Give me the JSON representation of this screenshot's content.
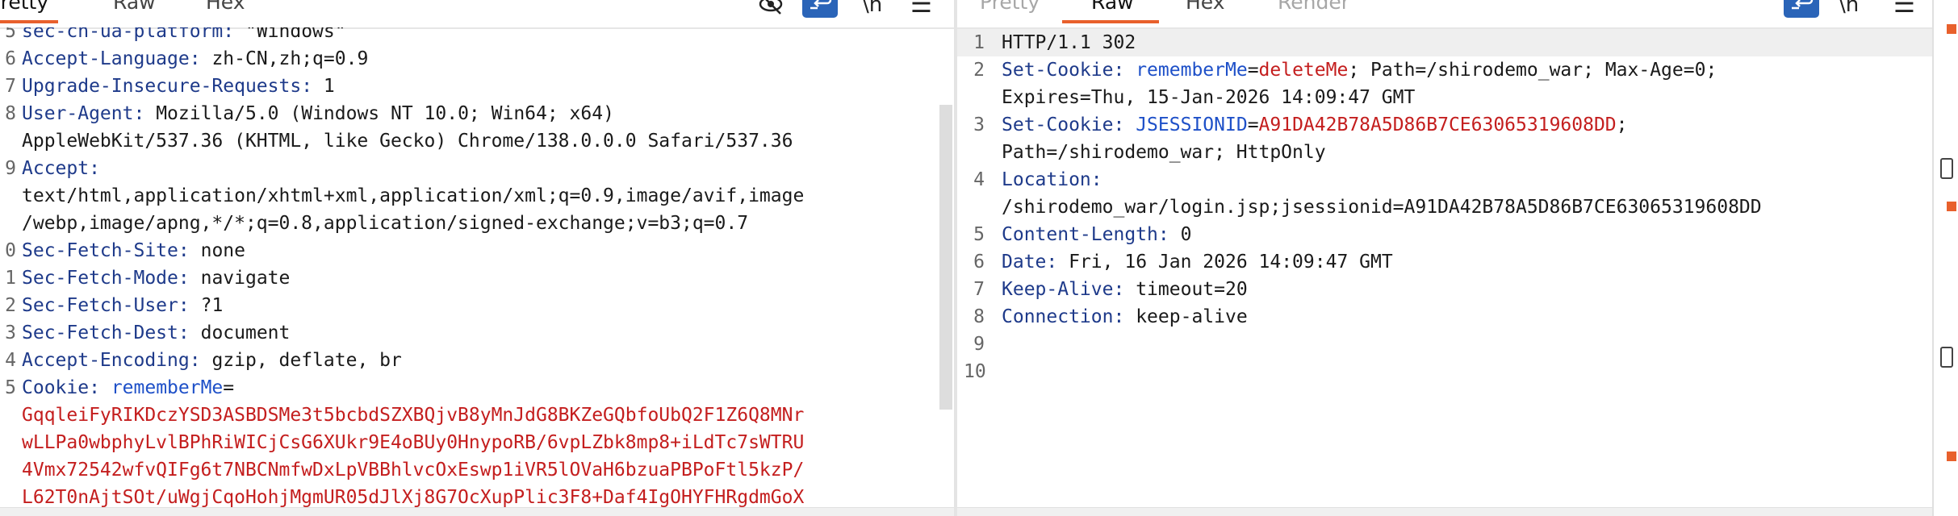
{
  "request": {
    "tabs": [
      "Pretty",
      "Raw",
      "Hex"
    ],
    "active_tab": "Pretty",
    "line_numbers": [
      "5",
      "6",
      "7",
      "8",
      "",
      "9",
      "",
      "",
      "0",
      "1",
      "2",
      "3",
      "4",
      "5",
      "",
      "",
      "",
      ""
    ],
    "lines": [
      {
        "k": "sec-ch-ua-platform",
        "v": "\"Windows\""
      },
      {
        "k": "Accept-Language",
        "v": "zh-CN,zh;q=0.9"
      },
      {
        "k": "Upgrade-Insecure-Requests",
        "v": "1"
      },
      {
        "k": "User-Agent",
        "v": "Mozilla/5.0 (Windows NT 10.0; Win64; x64)"
      },
      {
        "v": "AppleWebKit/537.36 (KHTML, like Gecko) Chrome/138.0.0.0 Safari/537.36"
      },
      {
        "k": "Accept"
      },
      {
        "v": "text/html,application/xhtml+xml,application/xml;q=0.9,image/avif,image"
      },
      {
        "v": "/webp,image/apng,*/*;q=0.8,application/signed-exchange;v=b3;q=0.7"
      },
      {
        "k": "Sec-Fetch-Site",
        "v": "none"
      },
      {
        "k": "Sec-Fetch-Mode",
        "v": "navigate"
      },
      {
        "k": "Sec-Fetch-User",
        "v": "?1"
      },
      {
        "k": "Sec-Fetch-Dest",
        "v": "document"
      },
      {
        "k": "Accept-Encoding",
        "v": "gzip, deflate, br"
      },
      {
        "k": "Cookie",
        "n": "rememberMe",
        "eq": "="
      },
      {
        "r": "GqqleiFyRIKDczYSD3ASBDSMe3t5bcbdSZXBQjvB8yMnJdG8BKZeGQbfoUbQ2F1Z6Q8MNr"
      },
      {
        "r": "wLLPa0wbphyLvlBPhRiWICjCsG6XUkr9E4oBUy0HnypoRB/6vpLZbk8mp8+iLdTc7sWTRU"
      },
      {
        "r": "4Vmx72542wfvQIFg6t7NBCNmfwDxLpVBBhlvcOxEswp1iVR5lOVaH6bzuaPBPoFtl5kzP/"
      },
      {
        "r": "L62T0nAjtSOt/uWgjCqoHohjMgmUR05dJlXj8G7OcXupPlic3F8+Daf4IgOHYFHRgdmGoX"
      }
    ]
  },
  "response": {
    "tabs": [
      "Pretty",
      "Raw",
      "Hex",
      "Render"
    ],
    "active_tab": "Raw",
    "line_numbers": [
      "1",
      "2",
      "",
      "3",
      "",
      "4",
      "",
      "5",
      "6",
      "7",
      "8",
      "9",
      "10"
    ],
    "lines": [
      {
        "v": "HTTP/1.1 302"
      },
      {
        "k": "Set-Cookie",
        "n": "rememberMe",
        "eq": "=",
        "r": "deleteMe",
        "v": "; Path=/shirodemo_war; Max-Age=0;"
      },
      {
        "v": "Expires=Thu, 15-Jan-2026 14:09:47 GMT"
      },
      {
        "k": "Set-Cookie",
        "n": "JSESSIONID",
        "eq": "=",
        "r": "A91DA42B78A5D86B7CE63065319608DD",
        "v": ";"
      },
      {
        "v": "Path=/shirodemo_war; HttpOnly"
      },
      {
        "k": "Location"
      },
      {
        "v": "/shirodemo_war/login.jsp;jsessionid=A91DA42B78A5D86B7CE63065319608DD"
      },
      {
        "k": "Content-Length",
        "v": "0"
      },
      {
        "k": "Date",
        "v": "Fri, 16 Jan 2026 14:09:47 GMT"
      },
      {
        "k": "Keep-Alive",
        "v": "timeout=20"
      },
      {
        "k": "Connection",
        "v": "keep-alive"
      },
      {},
      {}
    ]
  },
  "icons": {
    "hide": "eye-slash-icon",
    "wrap": "wrap-lines-icon",
    "newline": "newline-icon",
    "menu": "menu-icon"
  },
  "colors": {
    "header_key": "#1e3a8a",
    "cookie_name": "#1e50c8",
    "cookie_value": "#c41e1e",
    "tab_underline": "#e8602c",
    "wrap_button": "#2a64b8"
  }
}
